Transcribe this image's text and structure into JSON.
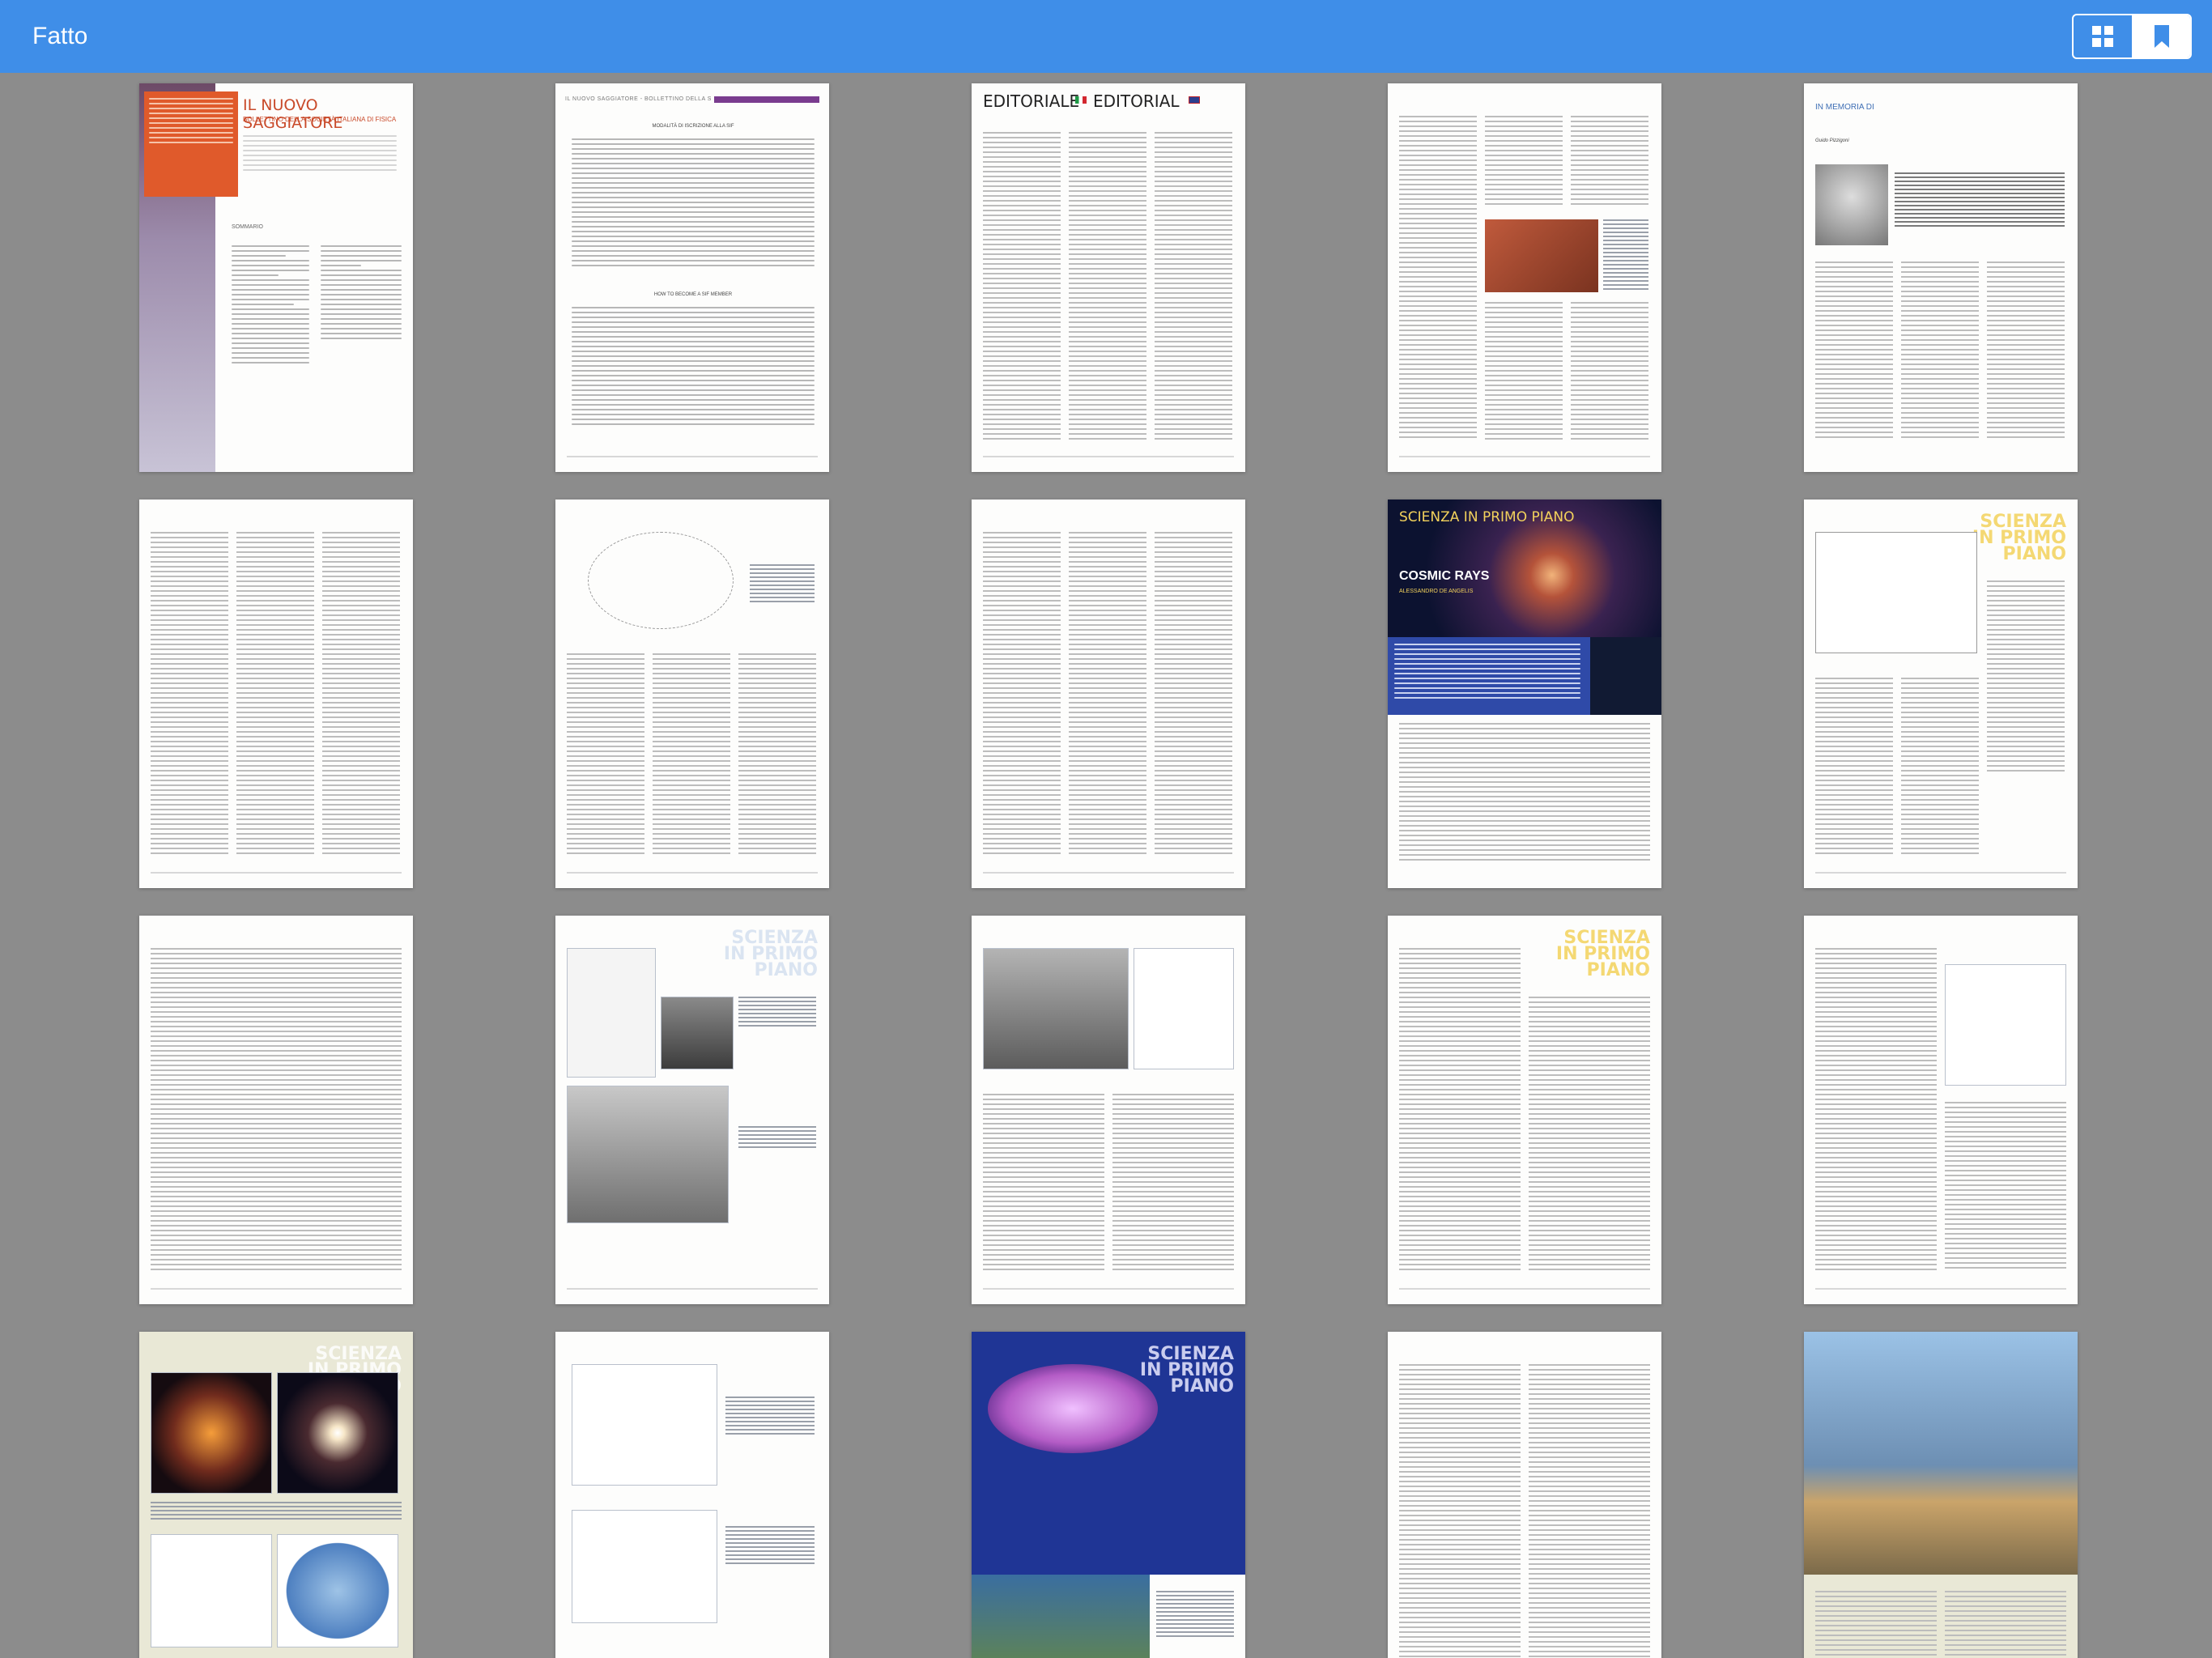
{
  "toolbar": {
    "done_label": "Fatto",
    "view_grid_icon": "grid-icon",
    "bookmark_icon": "bookmark-icon",
    "accent_color": "#3f8ee8"
  },
  "pages": {
    "p1": {
      "title": "IL NUOVO SAGGIATORE",
      "subtitle": "BOLLETTINO DELLA SOCIETÀ ITALIANA DI FISICA",
      "section": "SOMMARIO"
    },
    "p2": {
      "header": "IL NUOVO SAGGIATORE - BOLLETTINO DELLA SOCIETÀ ITALIANA DI FISICA",
      "heading_1": "MODALITÀ DI ISCRIZIONE ALLA SIF",
      "heading_2": "HOW TO BECOME A SIF MEMBER"
    },
    "p3": {
      "title_left": "EDITORIALE",
      "title_right": "EDITORIAL"
    },
    "p5": {
      "title": "IN MEMORIA DI",
      "name": "Guido Pizzigoni"
    },
    "p9": {
      "banner": "SCIENZA IN PRIMO PIANO",
      "article_title": "COSMIC RAYS",
      "author": "ALESSANDRO DE ANGELIS"
    },
    "p10": {
      "banner": "SCIENZA IN PRIMO PIANO"
    },
    "p12": {
      "banner": "SCIENZA IN PRIMO PIANO"
    },
    "p14": {
      "banner": "SCIENZA IN PRIMO PIANO"
    },
    "p16": {
      "banner": "SCIENZA IN PRIMO PIANO"
    },
    "p18": {
      "banner": "SCIENZA IN PRIMO PIANO"
    }
  }
}
